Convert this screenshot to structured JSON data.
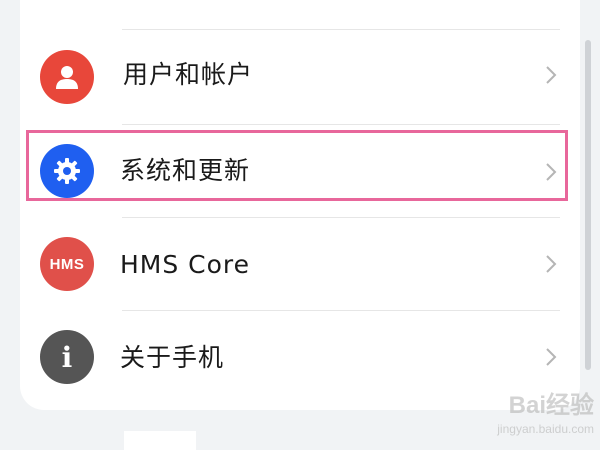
{
  "settings": {
    "items": [
      {
        "label": "用户和帐户",
        "icon": "user-icon",
        "color": "#e8473a"
      },
      {
        "label": "系统和更新",
        "icon": "gear-icon",
        "color": "#1f5ff0"
      },
      {
        "label": "HMS Core",
        "icon": "hms-icon",
        "icon_text": "HMS",
        "color": "#e0504a"
      },
      {
        "label": "关于手机",
        "icon": "info-icon",
        "icon_text": "i",
        "color": "#555555"
      }
    ],
    "highlighted_item": "系统和更新"
  },
  "watermark": {
    "brand": "Bai经验",
    "domain": "jingyan.baidu.com"
  }
}
